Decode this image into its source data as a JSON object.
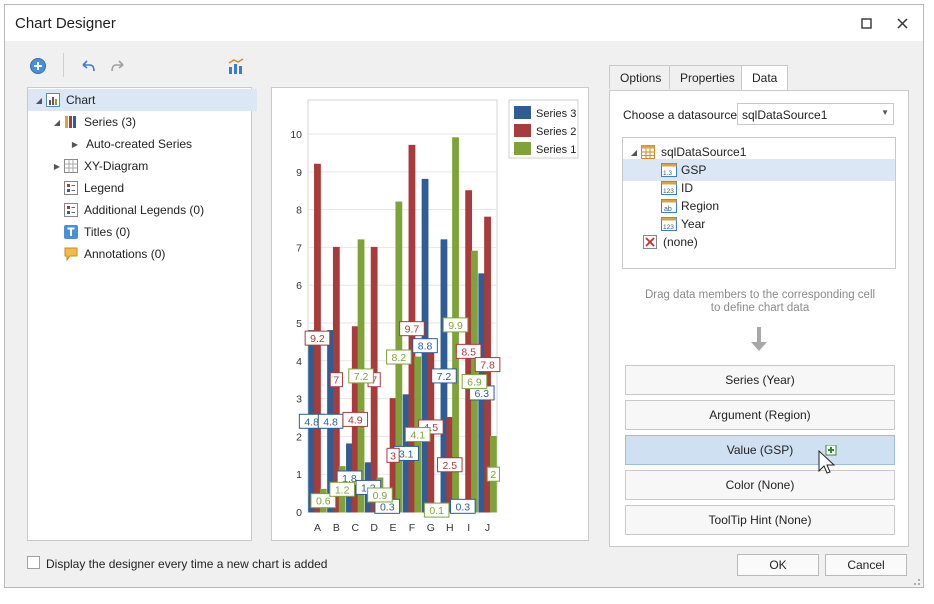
{
  "window": {
    "title": "Chart Designer"
  },
  "tree": {
    "items": [
      {
        "label": "Chart",
        "icon": "chart-icon"
      },
      {
        "label": "Series (3)",
        "icon": "series-icon"
      },
      {
        "label": "Auto-created Series",
        "icon": ""
      },
      {
        "label": "XY-Diagram",
        "icon": "diagram-icon"
      },
      {
        "label": "Legend",
        "icon": "legend-icon"
      },
      {
        "label": "Additional Legends (0)",
        "icon": "legend-icon"
      },
      {
        "label": "Titles (0)",
        "icon": "title-icon"
      },
      {
        "label": "Annotations (0)",
        "icon": "annotation-icon"
      }
    ]
  },
  "tabs": {
    "options": "Options",
    "properties": "Properties",
    "data": "Data"
  },
  "datasource": {
    "label": "Choose a datasource:",
    "value": "sqlDataSource1",
    "root": "sqlDataSource1",
    "fields": [
      {
        "name": "GSP",
        "type": "1.3"
      },
      {
        "name": "ID",
        "type": "123"
      },
      {
        "name": "Region",
        "type": "ab"
      },
      {
        "name": "Year",
        "type": "123"
      }
    ],
    "none": "(none)"
  },
  "hint": "Drag data members to the corresponding cell to define chart data",
  "drop_cells": [
    "Series (Year)",
    "Argument (Region)",
    "Value (GSP)",
    "Color (None)",
    "ToolTip Hint (None)"
  ],
  "footer": {
    "checkbox_label": "Display the designer every time a new chart is added",
    "ok": "OK",
    "cancel": "Cancel"
  },
  "colors": {
    "series3": "#2f5d95",
    "series2": "#a83b3b",
    "series1": "#7fa339",
    "accent": "#cfe0f3"
  },
  "chart_data": {
    "type": "bar",
    "categories": [
      "A",
      "B",
      "C",
      "D",
      "E",
      "F",
      "G",
      "H",
      "I",
      "J"
    ],
    "ylim": [
      0,
      10.9
    ],
    "yticks": [
      0,
      1,
      2,
      3,
      4,
      5,
      6,
      7,
      8,
      9,
      10
    ],
    "legend": "top-right",
    "series": [
      {
        "name": "Series 3",
        "color": "#2f5d95",
        "values": [
          4.8,
          4.8,
          1.8,
          1.3,
          0.3,
          3.1,
          8.8,
          7.2,
          0.3,
          6.3
        ]
      },
      {
        "name": "Series 2",
        "color": "#a83b3b",
        "values": [
          9.2,
          7.0,
          4.9,
          7.0,
          3.0,
          9.7,
          4.5,
          2.5,
          8.5,
          7.8
        ]
      },
      {
        "name": "Series 1",
        "color": "#7fa339",
        "values": [
          0.6,
          1.2,
          7.2,
          0.9,
          8.2,
          4.1,
          0.1,
          9.9,
          6.9,
          2.0
        ]
      }
    ],
    "labels": [
      [
        "4.8",
        "4.8",
        "1.8",
        "1.3",
        "0.3",
        "3.1",
        "8.8",
        "7.2",
        "0.3",
        "6.3"
      ],
      [
        "9.2",
        "7",
        "4.9",
        "7",
        "3",
        "9.7",
        "4.5",
        "2.5",
        "8.5",
        "7.8"
      ],
      [
        "0.6",
        "1.2",
        "7.2",
        "0.9",
        "8.2",
        "4.1",
        "0.1",
        "9.9",
        "6.9",
        "2"
      ]
    ]
  }
}
